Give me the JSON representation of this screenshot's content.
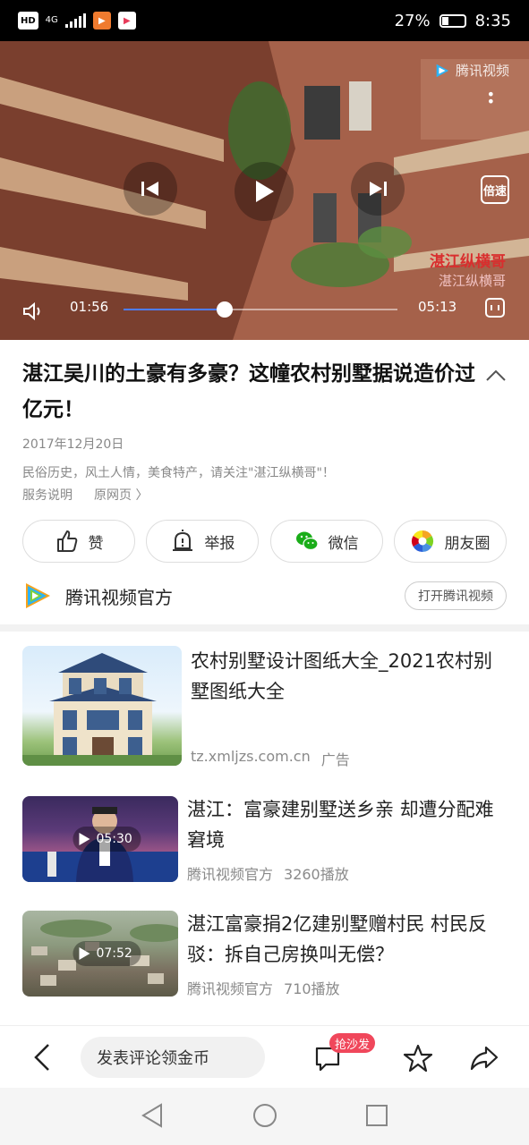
{
  "status_bar": {
    "hd": "HD",
    "network": "4G",
    "battery": "27%",
    "battery_level": 0.27,
    "time": "8:35"
  },
  "video": {
    "watermark": "腾讯视频",
    "channel_mark_line1": "湛江纵横哥",
    "channel_mark_line2": "湛江纵横哥",
    "speed_label": "倍速",
    "current_time": "01:56",
    "total_time": "05:13",
    "progress": 0.37
  },
  "article": {
    "title": "湛江吴川的土豪有多豪？这幢农村别墅据说造价过亿元！",
    "date": "2017年12月20日",
    "description": "民俗历史，风土人情，美食特产，请关注\"湛江纵横哥\"！",
    "service_link": "服务说明",
    "original_link": "原网页 〉"
  },
  "share": {
    "like": "赞",
    "report": "举报",
    "wechat": "微信",
    "moments": "朋友圈"
  },
  "source": {
    "name": "腾讯视频官方",
    "open_app": "打开腾讯视频"
  },
  "recommendations": [
    {
      "title": "农村别墅设计图纸大全_2021农村别墅图纸大全",
      "domain": "tz.xmljzs.com.cn",
      "tag": "广告"
    },
    {
      "title": "湛江：富豪建别墅送乡亲 却遭分配难窘境",
      "duration": "05:30",
      "author": "腾讯视频官方",
      "plays": "3260播放"
    },
    {
      "title": "湛江富豪捐2亿建别墅赠村民 村民反驳：拆自己房换叫无偿？",
      "duration": "07:52",
      "author": "腾讯视频官方",
      "plays": "710播放"
    }
  ],
  "bottom_bar": {
    "comment_placeholder": "发表评论领金币",
    "sofa_badge": "抢沙发"
  },
  "colors": {
    "accent_blue": "#4f7dff",
    "badge_red": "#f0475b",
    "wechat_green": "#1aad19"
  }
}
